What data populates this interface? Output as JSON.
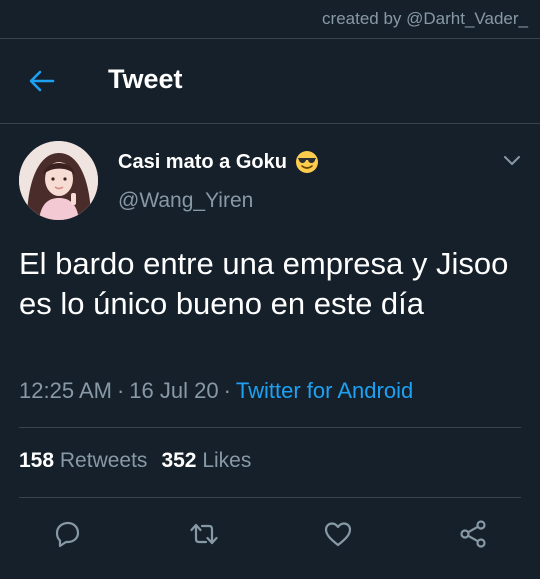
{
  "watermark": "created by @Darht_Vader_",
  "header": {
    "title": "Tweet"
  },
  "tweet": {
    "display_name": "Casi mato a Goku",
    "name_emoji": "smiling-face-with-sunglasses-icon",
    "handle": "@Wang_Yiren",
    "text": "El bardo entre una empresa y Jisoo es lo único bueno en este día",
    "time": "12:25 AM",
    "date": "16 Jul 20",
    "separator": "·",
    "source": "Twitter for Android",
    "retweets_count": "158",
    "retweets_label": "Retweets",
    "likes_count": "352",
    "likes_label": "Likes"
  },
  "icons": {
    "back": "arrow-left-icon",
    "more": "chevron-down-icon",
    "actions": [
      "reply-icon",
      "retweet-icon",
      "like-icon",
      "share-icon"
    ]
  },
  "colors": {
    "background": "#15202b",
    "accent": "#1da1f2",
    "secondary_text": "#8899a6",
    "divider": "#38444d"
  }
}
